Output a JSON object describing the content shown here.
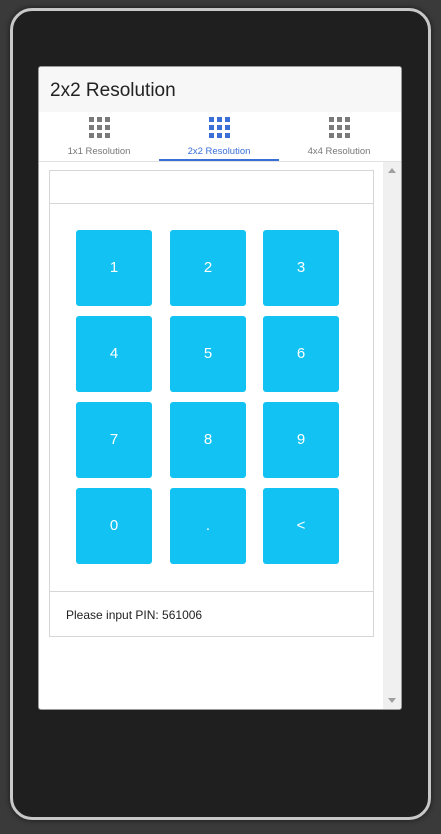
{
  "window": {
    "title": "2x2 Resolution"
  },
  "tabs": [
    {
      "label": "1x1 Resolution",
      "icon": "grid-icon",
      "active": false
    },
    {
      "label": "2x2 Resolution",
      "icon": "grid-icon",
      "active": true
    },
    {
      "label": "4x4 Resolution",
      "icon": "grid-icon",
      "active": false
    }
  ],
  "pin_entry": {
    "value": ""
  },
  "keypad": {
    "keys": [
      "1",
      "2",
      "3",
      "4",
      "5",
      "6",
      "7",
      "8",
      "9",
      "0",
      ".",
      "<"
    ]
  },
  "status": {
    "text": "Please input PIN: 561006"
  },
  "colors": {
    "key_background": "#12c2f2",
    "active_tab": "#3a6fd8",
    "inactive_icon": "#7a7a7a"
  }
}
